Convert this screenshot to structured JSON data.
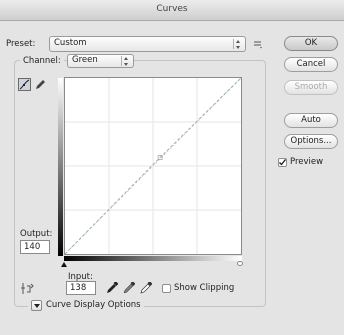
{
  "window": {
    "title": "Curves"
  },
  "preset": {
    "label": "Preset:",
    "value": "Custom"
  },
  "channel": {
    "label": "Channel:",
    "value": "Green"
  },
  "buttons": {
    "ok": "OK",
    "cancel": "Cancel",
    "smooth": "Smooth",
    "auto": "Auto",
    "options": "Options..."
  },
  "preview": {
    "label": "Preview",
    "checked": true
  },
  "output": {
    "label": "Output:",
    "value": "140"
  },
  "input": {
    "label": "Input:",
    "value": "138"
  },
  "show_clipping": {
    "label": "Show Clipping",
    "checked": false
  },
  "curve_display_options": {
    "label": "Curve Display Options"
  },
  "icons": {
    "curve_tool": "curve-tool-icon",
    "pencil_tool": "pencil-icon",
    "target_adjust": "target-adjust-icon",
    "black_eyedropper": "black-point-eyedropper-icon",
    "gray_eyedropper": "gray-point-eyedropper-icon",
    "white_eyedropper": "white-point-eyedropper-icon",
    "preset_menu": "preset-options-icon",
    "disclosure": "disclosure-triangle-icon"
  },
  "curve": {
    "points": [
      [
        0,
        0
      ],
      [
        138,
        140
      ],
      [
        255,
        255
      ]
    ]
  }
}
